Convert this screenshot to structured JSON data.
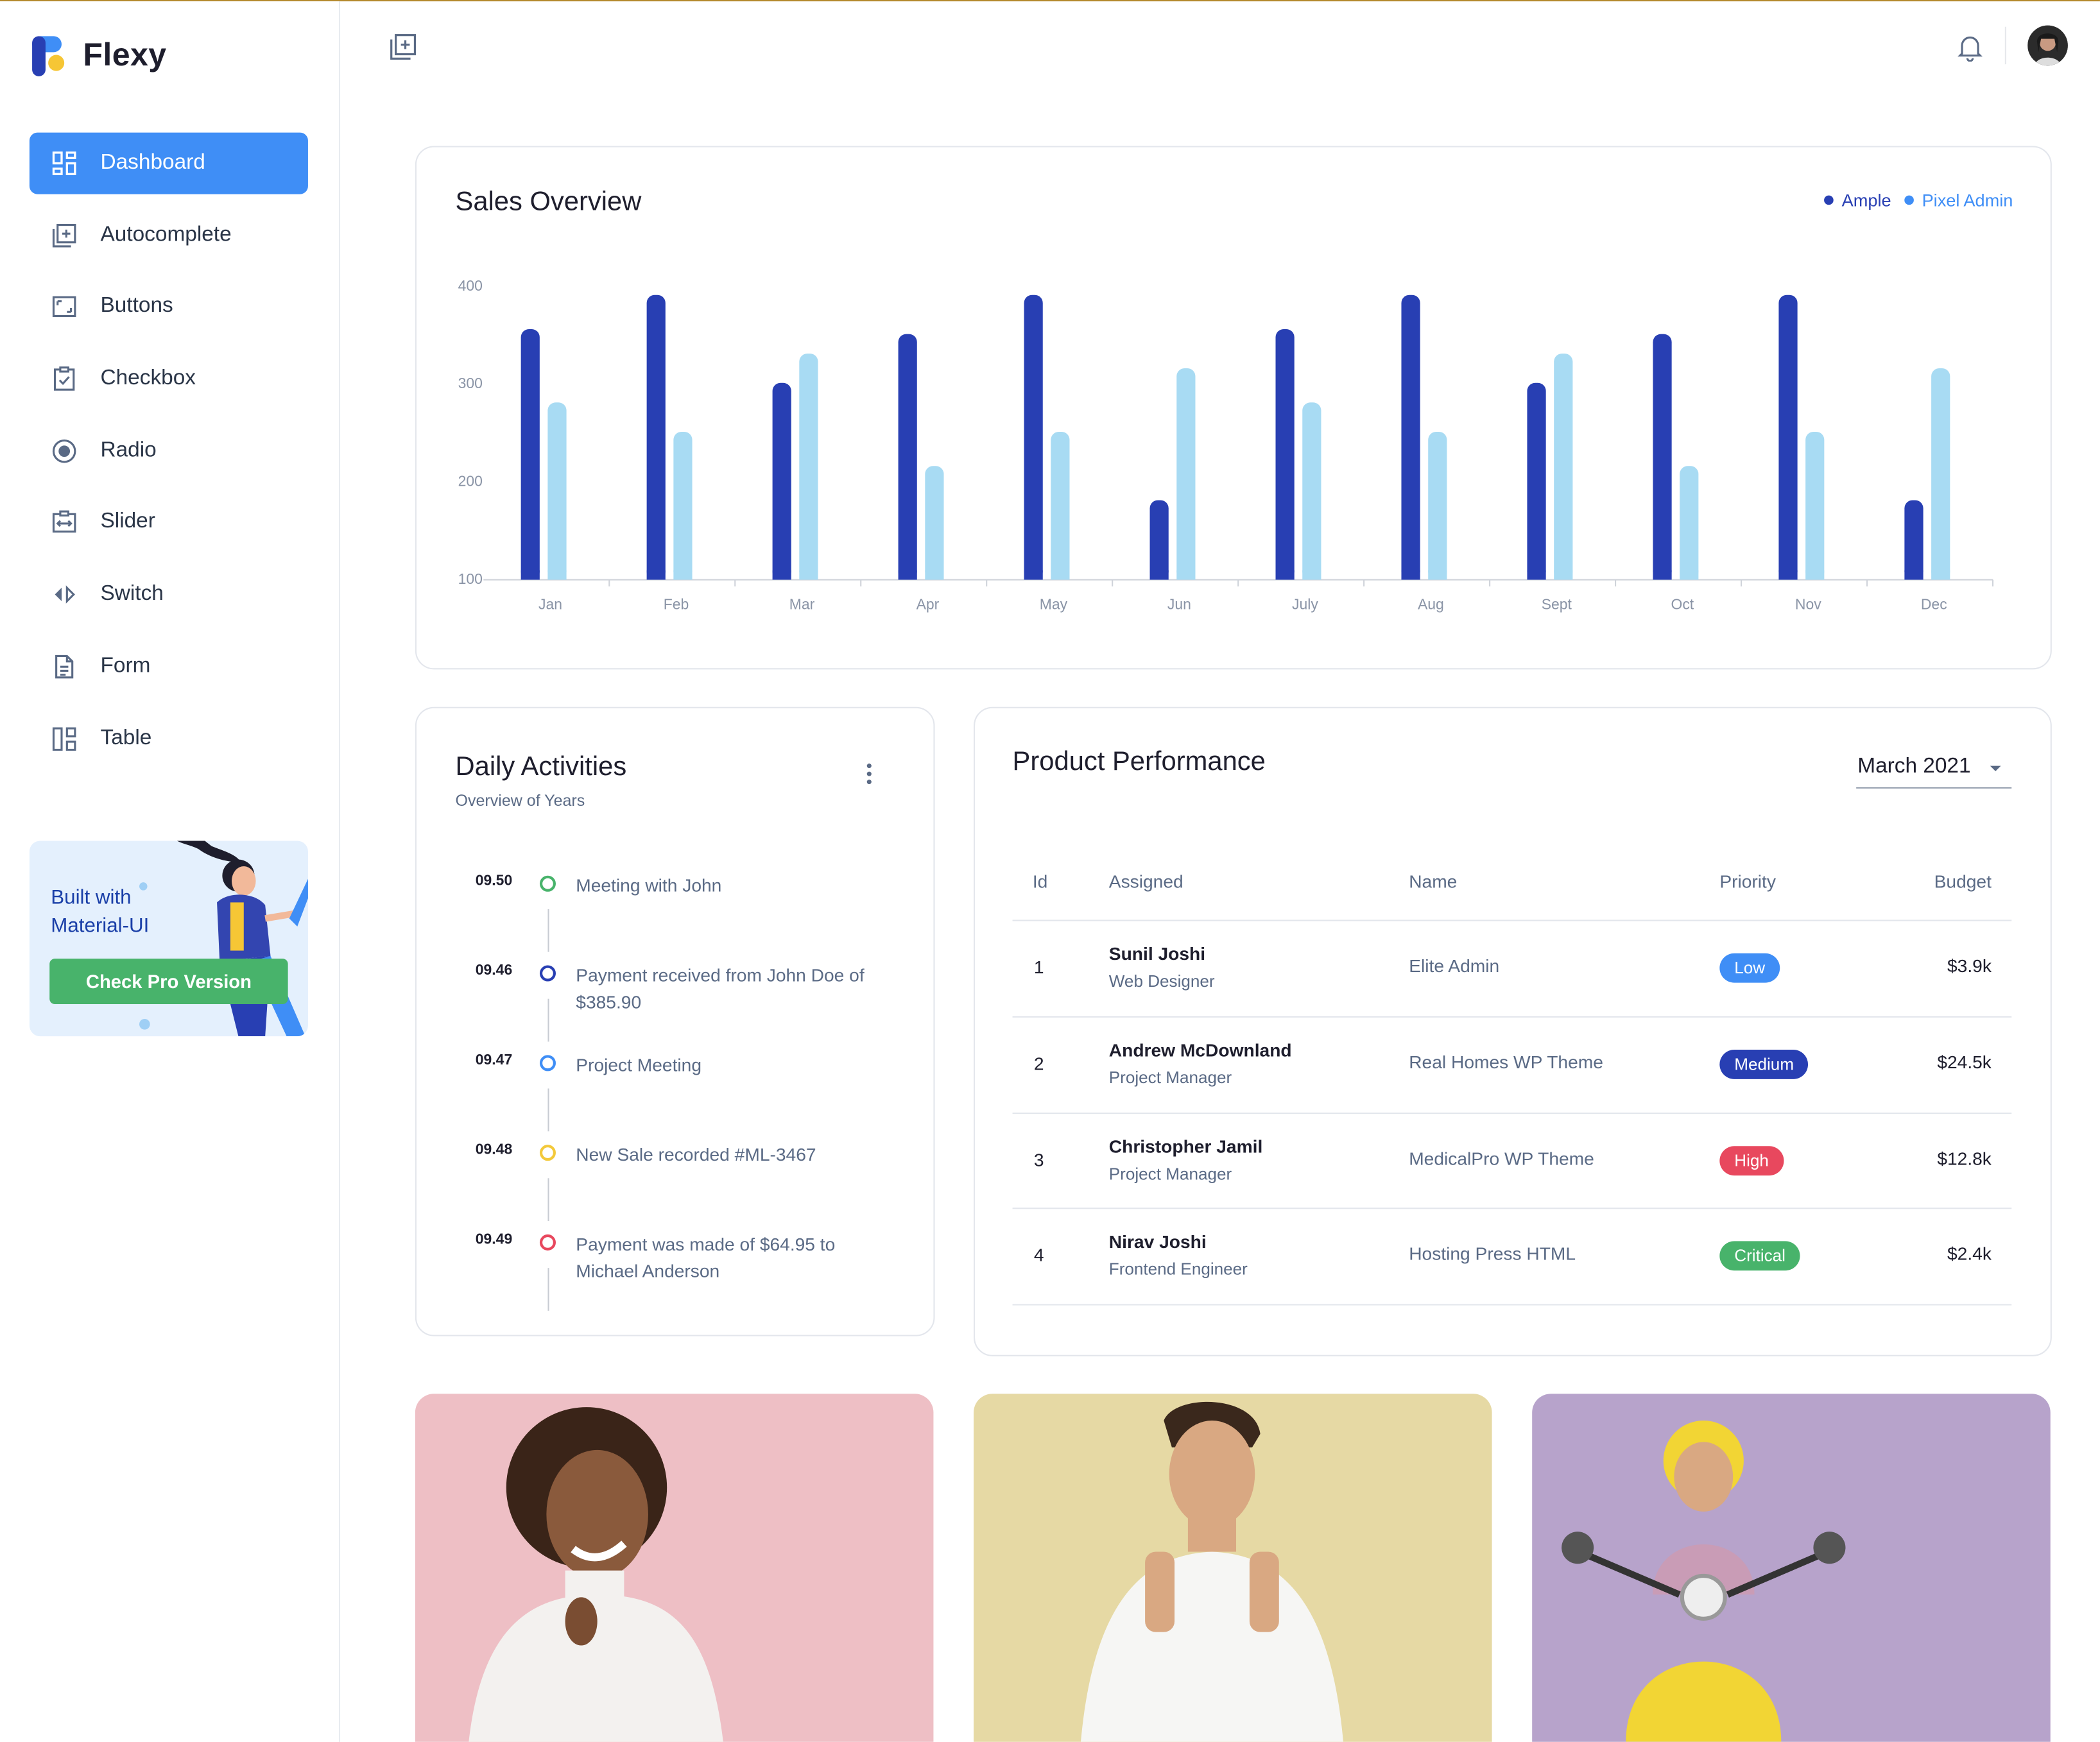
{
  "app": {
    "name": "Flexy"
  },
  "sidebar": {
    "items": [
      {
        "label": "Dashboard",
        "icon": "dashboard-icon",
        "active": true
      },
      {
        "label": "Autocomplete",
        "icon": "add-box-icon"
      },
      {
        "label": "Buttons",
        "icon": "expand-box-icon"
      },
      {
        "label": "Checkbox",
        "icon": "clipboard-check-icon"
      },
      {
        "label": "Radio",
        "icon": "radio-icon"
      },
      {
        "label": "Slider",
        "icon": "slider-icon"
      },
      {
        "label": "Switch",
        "icon": "switch-icon"
      },
      {
        "label": "Form",
        "icon": "file-icon"
      },
      {
        "label": "Table",
        "icon": "table-icon"
      }
    ],
    "promo": {
      "line1": "Built with",
      "line2": "Material-UI",
      "button": "Check Pro Version"
    }
  },
  "sales": {
    "title": "Sales Overview",
    "legend": [
      {
        "name": "Ample",
        "color": "#283fb3"
      },
      {
        "name": "Pixel Admin",
        "color": "#3f8ef6"
      }
    ]
  },
  "chart_data": {
    "type": "bar",
    "title": "Sales Overview",
    "categories": [
      "Jan",
      "Feb",
      "Mar",
      "Apr",
      "May",
      "Jun",
      "July",
      "Aug",
      "Sept",
      "Oct",
      "Nov",
      "Dec"
    ],
    "series": [
      {
        "name": "Ample",
        "color": "#283fb3",
        "values": [
          355,
          390,
          300,
          350,
          390,
          180,
          355,
          390,
          300,
          350,
          390,
          180
        ]
      },
      {
        "name": "Pixel Admin",
        "color": "#a8dbf3",
        "values": [
          280,
          250,
          330,
          215,
          250,
          315,
          280,
          250,
          330,
          215,
          250,
          315
        ]
      }
    ],
    "yticks": [
      100,
      200,
      300,
      400
    ],
    "ylim": [
      100,
      400
    ],
    "grid": false,
    "legend": "top-right"
  },
  "daily": {
    "title": "Daily Activities",
    "subtitle": "Overview of Years",
    "items": [
      {
        "time": "09.50",
        "text": "Meeting with John",
        "color": "#48b36b"
      },
      {
        "time": "09.46",
        "text": "Payment received from John Doe of $385.90",
        "color": "#283fb3"
      },
      {
        "time": "09.47",
        "text": "Project Meeting",
        "color": "#3f8ef6"
      },
      {
        "time": "09.48",
        "text": "New Sale recorded #ML-3467",
        "color": "#f3c93b"
      },
      {
        "time": "09.49",
        "text": "Payment was made of $64.95 to Michael Anderson",
        "color": "#e8485e"
      }
    ]
  },
  "product": {
    "title": "Product Performance",
    "period": "March 2021",
    "headers": {
      "id": "Id",
      "assigned": "Assigned",
      "name": "Name",
      "priority": "Priority",
      "budget": "Budget"
    },
    "rows": [
      {
        "id": "1",
        "person": "Sunil Joshi",
        "role": "Web Designer",
        "name": "Elite Admin",
        "priority": "Low",
        "color": "#3f8ef6",
        "budget": "$3.9k"
      },
      {
        "id": "2",
        "person": "Andrew McDownland",
        "role": "Project Manager",
        "name": "Real Homes WP Theme",
        "priority": "Medium",
        "color": "#283fb3",
        "budget": "$24.5k"
      },
      {
        "id": "3",
        "person": "Christopher Jamil",
        "role": "Project Manager",
        "name": "MedicalPro WP Theme",
        "priority": "High",
        "color": "#e8485e",
        "budget": "$12.8k"
      },
      {
        "id": "4",
        "person": "Nirav Joshi",
        "role": "Frontend Engineer",
        "name": "Hosting Press HTML",
        "priority": "Critical",
        "color": "#48b36b",
        "budget": "$2.4k"
      }
    ]
  },
  "photos": [
    {
      "bg": "#eebfc5"
    },
    {
      "bg": "#e6d9a4"
    },
    {
      "bg": "#b7a3cb"
    }
  ]
}
